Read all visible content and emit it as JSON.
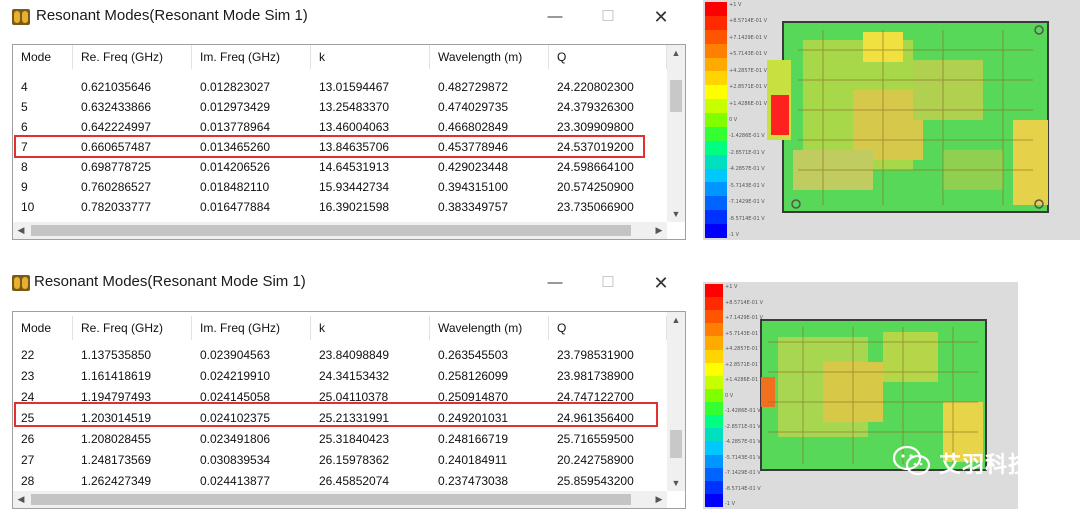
{
  "windows": [
    {
      "title": "Resonant Modes(Resonant Mode Sim 1)",
      "columns": [
        "Mode",
        "Re. Freq (GHz)",
        "Im. Freq (GHz)",
        "k",
        "Wavelength (m)",
        "Q"
      ],
      "rows": [
        [
          "4",
          "0.621035646",
          "0.012823027",
          "13.01594467",
          "0.482729872",
          "24.220802300"
        ],
        [
          "5",
          "0.632433866",
          "0.012973429",
          "13.25483370",
          "0.474029735",
          "24.379326300"
        ],
        [
          "6",
          "0.642224997",
          "0.013778964",
          "13.46004063",
          "0.466802849",
          "23.309909800"
        ],
        [
          "7",
          "0.660657487",
          "0.013465260",
          "13.84635706",
          "0.453778946",
          "24.537019200"
        ],
        [
          "8",
          "0.698778725",
          "0.014206526",
          "14.64531913",
          "0.429023448",
          "24.598664100"
        ],
        [
          "9",
          "0.760286527",
          "0.018482110",
          "15.93442734",
          "0.394315100",
          "20.574250900"
        ],
        [
          "10",
          "0.782033777",
          "0.016477884",
          "16.39021598",
          "0.383349757",
          "23.735066900"
        ]
      ],
      "highlighted_mode": "7"
    },
    {
      "title": "Resonant Modes(Resonant Mode Sim 1)",
      "columns": [
        "Mode",
        "Re. Freq (GHz)",
        "Im. Freq (GHz)",
        "k",
        "Wavelength (m)",
        "Q"
      ],
      "rows": [
        [
          "22",
          "1.137535850",
          "0.023904563",
          "23.84098849",
          "0.263545503",
          "23.798531900"
        ],
        [
          "23",
          "1.161418619",
          "0.024219910",
          "24.34153432",
          "0.258126099",
          "23.981738900"
        ],
        [
          "24",
          "1.194797493",
          "0.024145058",
          "25.04110378",
          "0.250914870",
          "24.747122700"
        ],
        [
          "25",
          "1.203014519",
          "0.024102375",
          "25.21331991",
          "0.249201031",
          "24.961356400"
        ],
        [
          "26",
          "1.208028455",
          "0.023491806",
          "25.31840423",
          "0.248166719",
          "25.716559500"
        ],
        [
          "27",
          "1.248173569",
          "0.030839534",
          "26.15978362",
          "0.240184911",
          "20.242758900"
        ],
        [
          "28",
          "1.262427349",
          "0.024413877",
          "26.45852074",
          "0.237473038",
          "25.859543200"
        ]
      ],
      "highlighted_mode": "25"
    }
  ],
  "window_controls": {
    "minimize": "—",
    "maximize": "☐",
    "close": "✕"
  },
  "scrollbar_glyphs": {
    "up": "▲",
    "down": "▼",
    "left": "◀",
    "right": "▶"
  },
  "simulation_images": [
    {
      "color_scale": [
        "#ff0000",
        "#ff2a00",
        "#ff5500",
        "#ff8000",
        "#ffaa00",
        "#ffd400",
        "#ffff00",
        "#c8ff00",
        "#80ff00",
        "#33ff33",
        "#00ff80",
        "#00e0c0",
        "#00c8ff",
        "#0096ff",
        "#0064ff",
        "#0032ff",
        "#0000ff"
      ],
      "scale_labels": [
        "+1 V",
        "+8.5714E-01 V",
        "+7.1429E-01 V",
        "+5.7143E-01 V",
        "+4.2857E-01 V",
        "+2.8571E-01 V",
        "+1.4286E-01 V",
        "0 V",
        "-1.4286E-01 V",
        "-2.8571E-01 V",
        "-4.2857E-01 V",
        "-5.7143E-01 V",
        "-7.1429E-01 V",
        "-8.5714E-01 V",
        "-1 V"
      ]
    },
    {
      "color_scale": [
        "#ff0000",
        "#ff2a00",
        "#ff5500",
        "#ff8000",
        "#ffaa00",
        "#ffd400",
        "#ffff00",
        "#c8ff00",
        "#80ff00",
        "#33ff33",
        "#00ff80",
        "#00e0c0",
        "#00c8ff",
        "#0096ff",
        "#0064ff",
        "#0032ff",
        "#0000ff"
      ],
      "scale_labels": [
        "+1 V",
        "+8.5714E-01 V",
        "+7.1429E-01 V",
        "+5.7143E-01 V",
        "+4.2857E-01 V",
        "+2.8571E-01 V",
        "+1.4286E-01 V",
        "0 V",
        "-1.4286E-01 V",
        "-2.8571E-01 V",
        "-4.2857E-01 V",
        "-5.7143E-01 V",
        "-7.1429E-01 V",
        "-8.5714E-01 V",
        "-1 V"
      ]
    }
  ],
  "watermark": {
    "text": "艾羽科技",
    "icon": "wechat-icon"
  }
}
